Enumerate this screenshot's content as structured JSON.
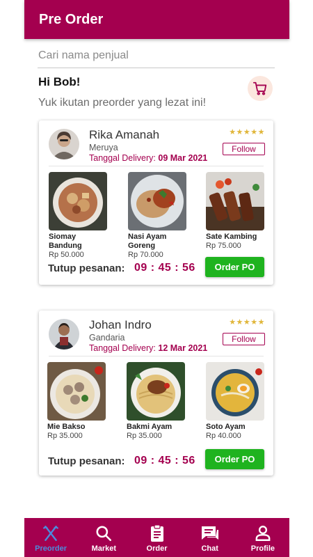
{
  "appbar": {
    "title": "Pre Order"
  },
  "search": {
    "placeholder": "Cari nama penjual",
    "value": ""
  },
  "greeting": "Hi Bob!",
  "subtitle": "Yuk ikutan preorder yang lezat ini!",
  "cart": {
    "icon": "cart-icon"
  },
  "theme": {
    "primary": "#a4004f",
    "accent_green": "#1fb31f",
    "star": "#e0b63a",
    "nav_active": "#4c8bdc"
  },
  "sellers": [
    {
      "name": "Rika Amanah",
      "location": "Meruya",
      "delivery_label": "Tanggal Delivery:",
      "delivery_date": "09 Mar 2021",
      "rating": 5,
      "stars": "★★★★★",
      "follow_label": "Follow",
      "products": [
        {
          "name": "Siomay Bandung",
          "price": "Rp 50.000"
        },
        {
          "name": "Nasi Ayam Goreng",
          "price": "Rp 70.000"
        },
        {
          "name": "Sate Kambing",
          "price": "Rp 75.000"
        }
      ],
      "close_label": "Tutup pesanan:",
      "countdown": "09 : 45 : 56",
      "order_label": "Order PO"
    },
    {
      "name": "Johan Indro",
      "location": "Gandaria",
      "delivery_label": "Tanggal Delivery:",
      "delivery_date": "12 Mar 2021",
      "rating": 5,
      "stars": "★★★★★",
      "follow_label": "Follow",
      "products": [
        {
          "name": "Mie Bakso",
          "price": "Rp 35.000"
        },
        {
          "name": "Bakmi Ayam",
          "price": "Rp 35.000"
        },
        {
          "name": "Soto Ayam",
          "price": "Rp 40.000"
        }
      ],
      "close_label": "Tutup pesanan:",
      "countdown": "09 : 45 : 56",
      "order_label": "Order PO"
    }
  ],
  "nav": {
    "active": "Preorder",
    "items": [
      {
        "label": "Preorder",
        "icon": "utensils-icon"
      },
      {
        "label": "Market",
        "icon": "search-icon"
      },
      {
        "label": "Order",
        "icon": "clipboard-icon"
      },
      {
        "label": "Chat",
        "icon": "chat-icon"
      },
      {
        "label": "Profile",
        "icon": "person-icon"
      }
    ]
  }
}
